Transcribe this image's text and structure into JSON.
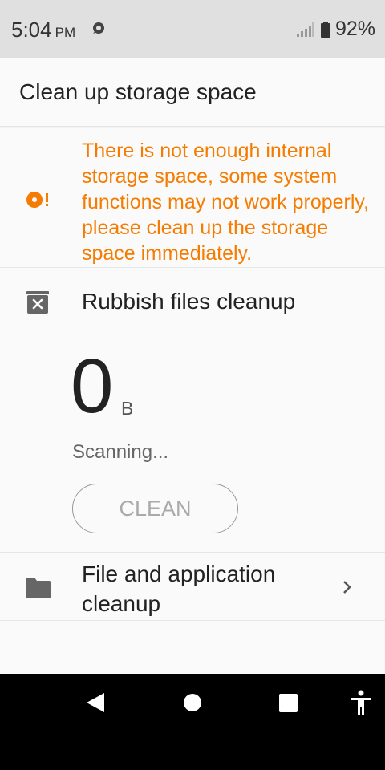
{
  "status_bar": {
    "time": "5:04",
    "ampm": "PM",
    "battery": "92%"
  },
  "app_bar": {
    "title": "Clean up storage space"
  },
  "warning": {
    "text": "There is not enough internal storage space, some system functions may not work properly, please clean up the storage space immediately."
  },
  "rubbish": {
    "label": "Rubbish files cleanup",
    "size_value": "0",
    "size_unit": "B",
    "status": "Scanning...",
    "clean_label": "CLEAN"
  },
  "file_cleanup": {
    "label": "File and application cleanup"
  },
  "colors": {
    "warning": "#f57c00",
    "status_bar_bg": "#e0e0e0",
    "nav_bar_bg": "#000000"
  },
  "icons": [
    "notification-icon",
    "signal-icon",
    "battery-icon",
    "warning-icon",
    "rubbish-icon",
    "folder-icon",
    "chevron-right-icon",
    "back-icon",
    "home-icon",
    "recents-icon",
    "accessibility-icon"
  ]
}
